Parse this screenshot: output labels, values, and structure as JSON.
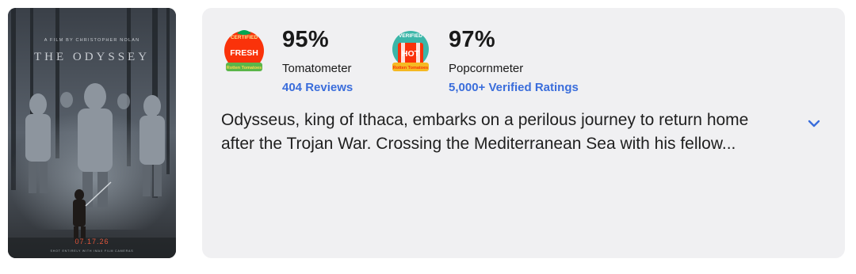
{
  "poster": {
    "tagline": "A FILM BY CHRISTOPHER NOLAN",
    "title": "THE ODYSSEY",
    "date": "07.17.26",
    "footer": "SHOT ENTIRELY WITH IMAX FILM CAMERAS"
  },
  "tomatometer": {
    "badge_top": "CERTIFIED",
    "badge_main": "FRESH",
    "badge_brand": "Rotten Tomatoes",
    "score": "95%",
    "label": "Tomatometer",
    "link": "404 Reviews",
    "badge_color": "#fa320a"
  },
  "popcornmeter": {
    "badge_top": "VERIFIED",
    "badge_main": "HOT",
    "badge_brand": "Rotten Tomatoes",
    "score": "97%",
    "label": "Popcornmeter",
    "link": "5,000+ Verified Ratings",
    "badge_color": "#3bb6a8"
  },
  "synopsis": {
    "text": "Odysseus, king of Ithaca, embarks on a perilous journey to return home after the Trojan War. Crossing the Mediterranean Sea with his fellow..."
  },
  "expand_icon": "chevron-down-icon",
  "colors": {
    "link": "#3a6ddb",
    "card_bg": "#f0f0f2"
  }
}
